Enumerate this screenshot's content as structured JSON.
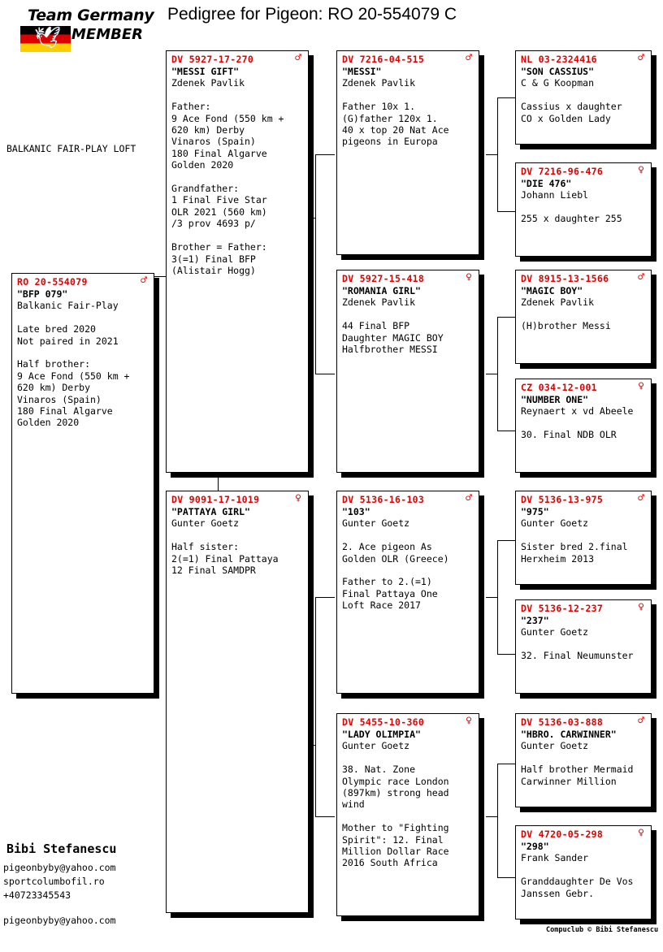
{
  "logo": {
    "line1": "Team Germany",
    "line2": "MEMBER",
    "dove_icon": "dove-icon",
    "flag_icon": "german-flag-icon"
  },
  "title": "Pedigree for Pigeon: RO  20-554079 C",
  "loft_name": "BALKANIC FAIR-PLAY LOFT",
  "subject": {
    "ring": "RO   20-554079",
    "sex": "male",
    "sex_glyph": "♂",
    "name": "\"BFP 079\"",
    "breeder": "Balkanic Fair-Play",
    "notes": "Late bred 2020\nNot paired in 2021\n\nHalf brother:\n9 Ace Fond (550 km +\n620 km) Derby\nVinaros (Spain)\n180 Final Algarve\nGolden 2020"
  },
  "generation1": [
    {
      "ring": "DV   5927-17-270",
      "sex": "male",
      "sex_glyph": "♂",
      "name": "\"MESSI GIFT\"",
      "breeder": "Zdenek Pavlik",
      "notes": "Father:\n9 Ace Fond (550 km +\n620 km) Derby\nVinaros (Spain)\n180 Final Algarve\nGolden 2020\n\nGrandfather:\n1 Final Five Star\nOLR 2021 (560 km)\n/3 prov 4693 p/\n\nBrother = Father:\n3(=1) Final BFP\n(Alistair Hogg)"
    },
    {
      "ring": "DV   9091-17-1019",
      "sex": "female",
      "sex_glyph": "♀",
      "name": "\"PATTAYA GIRL\"",
      "breeder": "Gunter Goetz",
      "notes": "Half sister:\n2(=1) Final Pattaya\n12 Final SAMDPR"
    }
  ],
  "generation2": [
    {
      "ring": "DV   7216-04-515",
      "sex": "male",
      "sex_glyph": "♂",
      "name": "\"MESSI\"",
      "breeder": "Zdenek Pavlik",
      "notes": "Father 10x 1.\n(G)father 120x 1.\n40 x top 20 Nat Ace\npigeons in Europa"
    },
    {
      "ring": "DV   5927-15-418",
      "sex": "female",
      "sex_glyph": "♀",
      "name": "\"ROMANIA GIRL\"",
      "breeder": "Zdenek Pavlik",
      "notes": "44 Final BFP\nDaughter MAGIC BOY\nHalfbrother MESSI"
    },
    {
      "ring": "DV   5136-16-103",
      "sex": "male",
      "sex_glyph": "♂",
      "name": "\"103\"",
      "breeder": "Gunter Goetz",
      "notes": "2. Ace pigeon As\nGolden OLR (Greece)\n\nFather to 2.(=1)\nFinal Pattaya One\nLoft Race 2017"
    },
    {
      "ring": "DV   5455-10-360",
      "sex": "female",
      "sex_glyph": "♀",
      "name": "\"LADY OLIMPIA\"",
      "breeder": "Gunter Goetz",
      "notes": "38. Nat. Zone\nOlympic race London\n(897km) strong head\nwind\n\nMother to \"Fighting\nSpirit\": 12. Final\nMillion Dollar Race\n2016 South Africa"
    }
  ],
  "generation3": [
    {
      "ring": "NL   03-2324416",
      "sex": "male",
      "sex_glyph": "♂",
      "name": "\"SON CASSIUS\"",
      "breeder": "C & G Koopman",
      "notes": "Cassius x daughter\nCO x Golden Lady"
    },
    {
      "ring": "DV   7216-96-476",
      "sex": "female",
      "sex_glyph": "♀",
      "name": "\"DIE 476\"",
      "breeder": "Johann Liebl",
      "notes": "255 x daughter 255"
    },
    {
      "ring": "DV   8915-13-1566",
      "sex": "male",
      "sex_glyph": "♂",
      "name": "\"MAGIC BOY\"",
      "breeder": "Zdenek Pavlik",
      "notes": "(H)brother Messi"
    },
    {
      "ring": "CZ   034-12-001",
      "sex": "female",
      "sex_glyph": "♀",
      "name": "\"NUMBER ONE\"",
      "breeder": "Reynaert x vd Abeele",
      "notes": "30. Final NDB OLR"
    },
    {
      "ring": "DV   5136-13-975",
      "sex": "male",
      "sex_glyph": "♂",
      "name": "\"975\"",
      "breeder": "Gunter Goetz",
      "notes": "Sister bred 2.final\nHerxheim 2013"
    },
    {
      "ring": "DV   5136-12-237",
      "sex": "female",
      "sex_glyph": "♀",
      "name": "\"237\"",
      "breeder": "Gunter Goetz",
      "notes": "32. Final Neumunster"
    },
    {
      "ring": "DV   5136-03-888",
      "sex": "male",
      "sex_glyph": "♂",
      "name": "\"HBRO. CARWINNER\"",
      "breeder": "Gunter Goetz",
      "notes": "Half brother Mermaid\nCarwinner Million"
    },
    {
      "ring": "DV   4720-05-298",
      "sex": "female",
      "sex_glyph": "♀",
      "name": "\"298\"",
      "breeder": "Frank Sander",
      "notes": "Granddaughter De Vos\nJanssen Gebr."
    }
  ],
  "footer": {
    "owner": "Bibi Stefanescu",
    "email": "pigeonbyby@yahoo.com",
    "website": "sportcolumbofil.ro",
    "phone": "+40723345543",
    "email2": "pigeonbyby@yahoo.com",
    "copyright": "Compuclub © Bibi Stefanescu"
  },
  "colors": {
    "ring_red": "#e00000",
    "text_black": "#000000",
    "background": "#ffffff"
  }
}
